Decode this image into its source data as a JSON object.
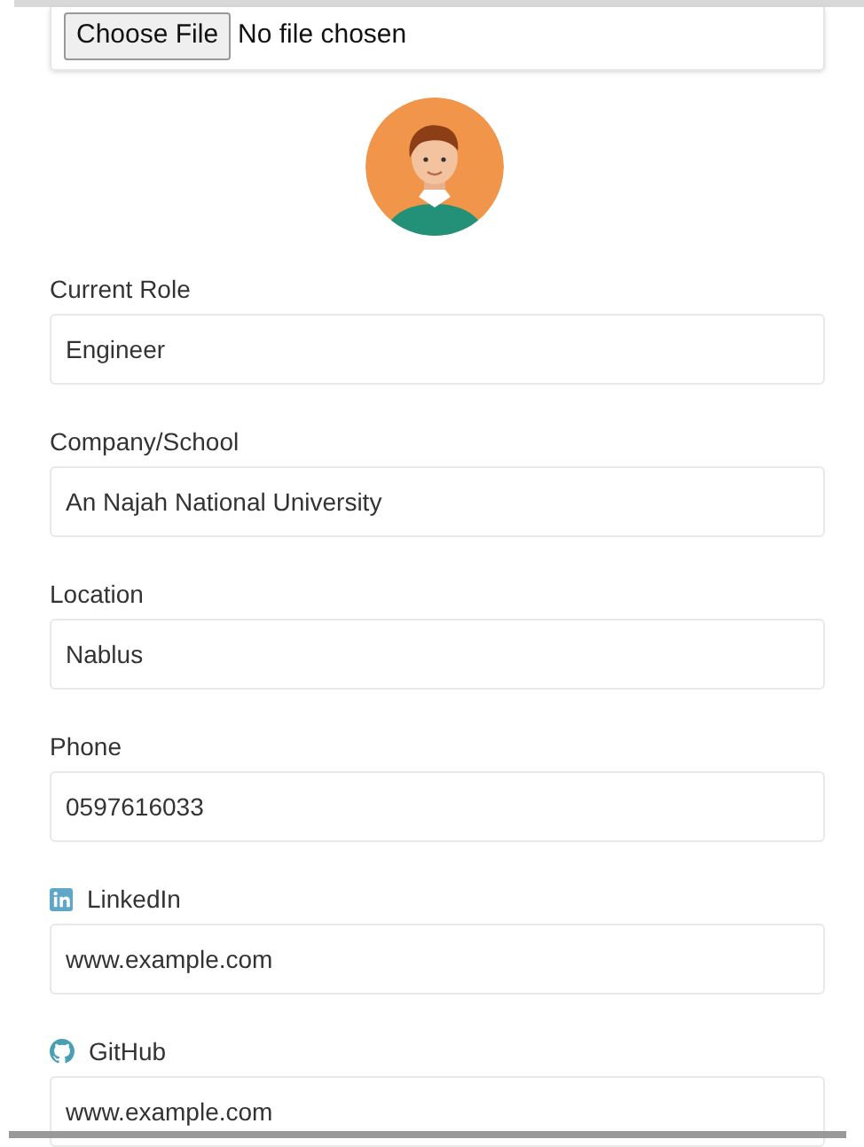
{
  "file_input": {
    "button": "Choose File",
    "status": "No file chosen"
  },
  "fields": [
    {
      "kind": "plain",
      "label": "Current Role",
      "value": "Engineer"
    },
    {
      "kind": "plain",
      "label": "Company/School",
      "value": "An Najah National University"
    },
    {
      "kind": "plain",
      "label": "Location",
      "value": "Nablus"
    },
    {
      "kind": "plain",
      "label": "Phone",
      "value": "0597616033"
    },
    {
      "kind": "linkedin",
      "label": "LinkedIn",
      "value": "www.example.com"
    },
    {
      "kind": "github",
      "label": "GitHub",
      "value": "www.example.com"
    }
  ]
}
